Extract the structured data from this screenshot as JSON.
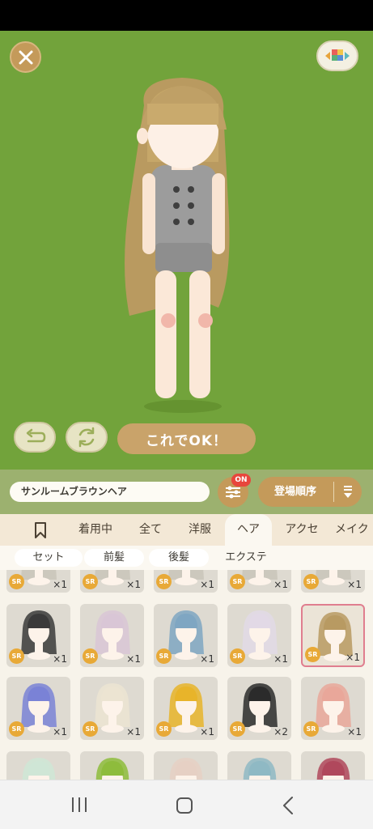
{
  "colors": {
    "stage_bg": "#72a33b",
    "accent": "#c49a5a",
    "badge": "#e8463c",
    "selected_border": "#e07e8f"
  },
  "header": {
    "close_icon": "close-icon",
    "palette_icon": "color-palette-icon"
  },
  "actions": {
    "undo_icon": "undo-icon",
    "shuffle_icon": "shuffle-icon",
    "ok_label": "これでOK！"
  },
  "filter": {
    "item_name": "サンルームブラウンヘア",
    "settings_badge": "ON",
    "sort_label": "登場順序"
  },
  "tabs": [
    {
      "label": "",
      "icon": "bookmark-icon"
    },
    {
      "label": "着用中"
    },
    {
      "label": "全て"
    },
    {
      "label": "洋服"
    },
    {
      "label": "ヘア",
      "active": true
    },
    {
      "label": "アクセ"
    },
    {
      "label": "メイク"
    }
  ],
  "subtabs": [
    {
      "label": "セット",
      "pill": true
    },
    {
      "label": "前髪",
      "pill": true
    },
    {
      "label": "後髪",
      "pill": true
    },
    {
      "label": "エクステ",
      "pill": false
    }
  ],
  "grid": {
    "rarity_label": "SR",
    "rows": [
      [
        {
          "count": "×1"
        },
        {
          "count": "×1"
        },
        {
          "count": "×1"
        },
        {
          "count": "×1"
        },
        {
          "count": "×1"
        }
      ],
      [
        {
          "count": "×1",
          "hair": "#3a3a3a"
        },
        {
          "count": "×1",
          "hair": "#d9c6d6"
        },
        {
          "count": "×1",
          "hair": "#7fa6c2"
        },
        {
          "count": "×1",
          "hair": "#e2d9e6"
        },
        {
          "count": "×1",
          "hair": "#b89a62",
          "selected": true
        }
      ],
      [
        {
          "count": "×1",
          "hair": "#7a82d6"
        },
        {
          "count": "×1",
          "hair": "#ece4d2"
        },
        {
          "count": "×1",
          "hair": "#e8b42a"
        },
        {
          "count": "×2",
          "hair": "#2b2b2b"
        },
        {
          "count": "×1",
          "hair": "#e9a79a"
        }
      ],
      [
        {
          "count": "",
          "hair": "#cfe6d6"
        },
        {
          "count": "",
          "hair": "#8ebc3c"
        },
        {
          "count": "",
          "hair": "#e6d0c4"
        },
        {
          "count": "",
          "hair": "#8fb9c4"
        },
        {
          "count": "",
          "hair": "#b0485c"
        }
      ]
    ]
  },
  "nav": {
    "recent_icon": "recent-apps-icon",
    "home_icon": "home-icon",
    "back_icon": "back-icon"
  }
}
